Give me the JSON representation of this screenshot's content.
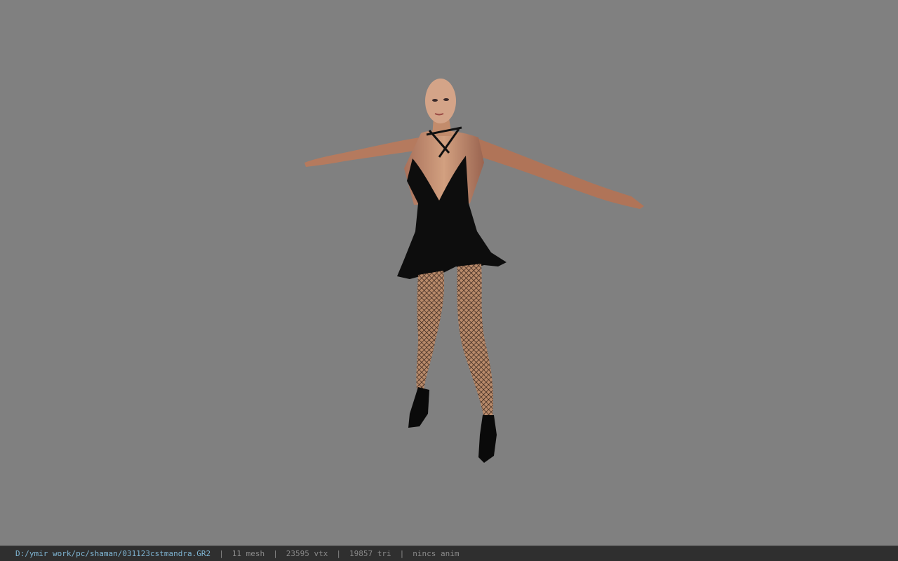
{
  "viewport": {
    "background_color": "#808080",
    "model_name": "3D character model"
  },
  "status_bar": {
    "file_path": "D:/ymir work/pc/shaman/031123cstmandra.GR2",
    "separator": "|",
    "mesh_count": "11 mesh",
    "vertex_count": "23595 vtx",
    "triangle_count": "19857 tri",
    "animation": "nincs anim",
    "path_color": "#7fb6d4",
    "text_color": "#8a8a8a"
  }
}
